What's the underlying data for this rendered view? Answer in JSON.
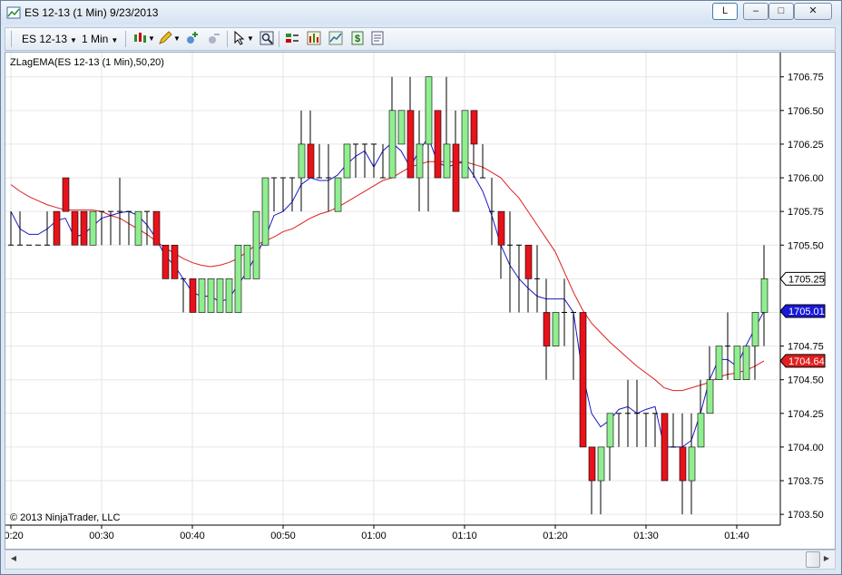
{
  "window": {
    "title": "ES 12-13 (1 Min)  9/23/2013",
    "buttons": {
      "layout": "L",
      "minimize": "–",
      "maximize": "□",
      "close": "✕"
    }
  },
  "toolbar": {
    "instrument": "ES 12-13",
    "interval": "1 Min",
    "icons": [
      "candlestick-style-icon",
      "pencil-draw-icon",
      "add-indicator-icon",
      "remove-indicator-icon",
      "cursor-icon",
      "zoom-icon",
      "strategies-icon",
      "chart-bars-icon",
      "data-box-icon",
      "money-icon",
      "properties-icon"
    ]
  },
  "colors": {
    "up_bar": "#90ee90",
    "down_bar": "#e8121b",
    "fast_ema": "#1919c8",
    "slow_ema": "#e01e1e",
    "grid": "#e6e6e6"
  },
  "chart": {
    "indicator_label": "ZLagEMA(ES 12-13 (1 Min),50,20)",
    "copyright": "© 2013 NinjaTrader, LLC",
    "price_badges": [
      {
        "text": "1705.25",
        "style": "last"
      },
      {
        "text": "1705.01",
        "style": "fast"
      },
      {
        "text": "1704.64",
        "style": "slow"
      }
    ]
  },
  "chart_data": {
    "type": "candlestick",
    "y_ticks": [
      "1706.75",
      "1706.50",
      "1706.25",
      "1706.00",
      "1705.75",
      "1705.50",
      "1705.25",
      "1705.00",
      "1704.75",
      "1704.50",
      "1704.25",
      "1704.00",
      "1703.75",
      "1703.50"
    ],
    "ylim": [
      1703.42,
      1706.93
    ],
    "x_ticks": [
      {
        "label": "00:20",
        "index": 0
      },
      {
        "label": "00:30",
        "index": 10
      },
      {
        "label": "00:40",
        "index": 20
      },
      {
        "label": "00:50",
        "index": 30
      },
      {
        "label": "01:00",
        "index": 40
      },
      {
        "label": "01:10",
        "index": 50
      },
      {
        "label": "01:20",
        "index": 60
      },
      {
        "label": "01:30",
        "index": 70
      },
      {
        "label": "01:40",
        "index": 80
      }
    ],
    "bars": [
      [
        1705.5,
        1705.75,
        1705.5,
        1705.5
      ],
      [
        1705.5,
        1705.75,
        1705.5,
        1705.5
      ],
      [
        1705.5,
        1705.5,
        1705.5,
        1705.5
      ],
      [
        1705.5,
        1705.5,
        1705.5,
        1705.5
      ],
      [
        1705.5,
        1705.75,
        1705.5,
        1705.5
      ],
      [
        1705.75,
        1705.75,
        1705.5,
        1705.5
      ],
      [
        1706.0,
        1706.0,
        1705.75,
        1705.75
      ],
      [
        1705.75,
        1705.75,
        1705.5,
        1705.5
      ],
      [
        1705.75,
        1705.75,
        1705.5,
        1705.5
      ],
      [
        1705.5,
        1705.75,
        1705.5,
        1705.75
      ],
      [
        1705.75,
        1705.75,
        1705.5,
        1705.75
      ],
      [
        1705.75,
        1705.75,
        1705.5,
        1705.75
      ],
      [
        1705.75,
        1706.0,
        1705.5,
        1705.75
      ],
      [
        1705.75,
        1705.75,
        1705.5,
        1705.75
      ],
      [
        1705.5,
        1705.75,
        1705.5,
        1705.75
      ],
      [
        1705.75,
        1705.75,
        1705.5,
        1705.75
      ],
      [
        1705.75,
        1705.75,
        1705.5,
        1705.5
      ],
      [
        1705.5,
        1705.5,
        1705.25,
        1705.25
      ],
      [
        1705.5,
        1705.5,
        1705.25,
        1705.25
      ],
      [
        1705.25,
        1705.25,
        1705.0,
        1705.25
      ],
      [
        1705.25,
        1705.25,
        1705.0,
        1705.0
      ],
      [
        1705.0,
        1705.25,
        1705.0,
        1705.25
      ],
      [
        1705.0,
        1705.25,
        1705.0,
        1705.25
      ],
      [
        1705.0,
        1705.25,
        1705.0,
        1705.25
      ],
      [
        1705.0,
        1705.25,
        1705.0,
        1705.25
      ],
      [
        1705.0,
        1705.5,
        1705.0,
        1705.5
      ],
      [
        1705.25,
        1705.5,
        1705.25,
        1705.5
      ],
      [
        1705.25,
        1705.75,
        1705.25,
        1705.75
      ],
      [
        1705.5,
        1706.0,
        1705.5,
        1706.0
      ],
      [
        1706.0,
        1706.0,
        1705.75,
        1706.0
      ],
      [
        1706.0,
        1706.0,
        1705.75,
        1706.0
      ],
      [
        1706.0,
        1706.0,
        1705.75,
        1706.0
      ],
      [
        1706.0,
        1706.5,
        1705.75,
        1706.25
      ],
      [
        1706.25,
        1706.5,
        1706.0,
        1706.0
      ],
      [
        1706.0,
        1706.25,
        1706.0,
        1706.0
      ],
      [
        1706.0,
        1706.25,
        1705.75,
        1706.0
      ],
      [
        1705.75,
        1706.0,
        1705.75,
        1706.0
      ],
      [
        1706.0,
        1706.25,
        1706.0,
        1706.25
      ],
      [
        1706.25,
        1706.25,
        1706.0,
        1706.25
      ],
      [
        1706.25,
        1706.25,
        1706.0,
        1706.25
      ],
      [
        1706.25,
        1706.25,
        1706.0,
        1706.25
      ],
      [
        1706.0,
        1706.25,
        1706.0,
        1706.0
      ],
      [
        1706.0,
        1706.75,
        1706.25,
        1706.5
      ],
      [
        1706.25,
        1706.5,
        1706.25,
        1706.5
      ],
      [
        1706.5,
        1706.75,
        1706.0,
        1706.0
      ],
      [
        1706.0,
        1706.5,
        1705.75,
        1706.25
      ],
      [
        1706.25,
        1706.75,
        1705.75,
        1706.75
      ],
      [
        1706.5,
        1706.5,
        1706.0,
        1706.0
      ],
      [
        1706.0,
        1706.75,
        1706.0,
        1706.25
      ],
      [
        1706.25,
        1706.5,
        1705.75,
        1705.75
      ],
      [
        1706.0,
        1706.5,
        1706.25,
        1706.5
      ],
      [
        1706.5,
        1706.5,
        1706.0,
        1706.25
      ],
      [
        1706.0,
        1706.25,
        1706.0,
        1706.0
      ],
      [
        1705.75,
        1706.0,
        1705.5,
        1705.75
      ],
      [
        1705.75,
        1705.75,
        1705.25,
        1705.5
      ],
      [
        1705.5,
        1705.75,
        1705.0,
        1705.5
      ],
      [
        1705.5,
        1705.5,
        1705.0,
        1705.5
      ],
      [
        1705.5,
        1705.5,
        1705.0,
        1705.25
      ],
      [
        1705.25,
        1705.5,
        1705.0,
        1705.25
      ],
      [
        1705.0,
        1705.25,
        1704.5,
        1704.75
      ],
      [
        1704.75,
        1705.0,
        1704.75,
        1705.0
      ],
      [
        1705.0,
        1705.25,
        1704.75,
        1705.0
      ],
      [
        1705.0,
        1705.0,
        1704.5,
        1705.0
      ],
      [
        1705.0,
        1705.0,
        1704.0,
        1704.0
      ],
      [
        1704.0,
        1704.0,
        1703.5,
        1703.75
      ],
      [
        1703.75,
        1704.0,
        1703.5,
        1704.0
      ],
      [
        1704.0,
        1704.25,
        1703.75,
        1704.25
      ],
      [
        1704.25,
        1704.25,
        1704.0,
        1704.25
      ],
      [
        1704.25,
        1704.5,
        1704.0,
        1704.25
      ],
      [
        1704.25,
        1704.5,
        1704.0,
        1704.25
      ],
      [
        1704.25,
        1704.25,
        1704.0,
        1704.25
      ],
      [
        1704.25,
        1704.25,
        1704.0,
        1704.25
      ],
      [
        1704.25,
        1704.25,
        1703.75,
        1703.75
      ],
      [
        1704.0,
        1704.25,
        1704.0,
        1704.0
      ],
      [
        1704.0,
        1704.25,
        1703.5,
        1703.75
      ],
      [
        1703.75,
        1704.25,
        1703.5,
        1704.0
      ],
      [
        1704.0,
        1704.5,
        1704.0,
        1704.25
      ],
      [
        1704.25,
        1704.75,
        1704.25,
        1704.5
      ],
      [
        1704.5,
        1704.75,
        1704.5,
        1704.75
      ],
      [
        1704.75,
        1705.0,
        1704.5,
        1704.75
      ],
      [
        1704.5,
        1704.75,
        1704.5,
        1704.75
      ],
      [
        1704.5,
        1704.75,
        1704.5,
        1704.75
      ],
      [
        1704.75,
        1705.0,
        1704.5,
        1705.0
      ],
      [
        1705.0,
        1705.5,
        1704.75,
        1705.25
      ]
    ],
    "series": [
      {
        "name": "fast",
        "values": [
          1705.75,
          1705.62,
          1705.58,
          1705.58,
          1705.62,
          1705.68,
          1705.7,
          1705.56,
          1705.58,
          1705.64,
          1705.7,
          1705.72,
          1705.74,
          1705.75,
          1705.72,
          1705.65,
          1705.55,
          1705.42,
          1705.35,
          1705.25,
          1705.15,
          1705.12,
          1705.12,
          1705.08,
          1705.1,
          1705.2,
          1705.3,
          1705.42,
          1705.55,
          1705.72,
          1705.75,
          1705.82,
          1705.95,
          1706.0,
          1705.98,
          1705.98,
          1706.02,
          1706.1,
          1706.16,
          1706.2,
          1706.08,
          1706.2,
          1706.26,
          1706.2,
          1706.08,
          1706.2,
          1706.3,
          1706.12,
          1706.08,
          1706.1,
          1706.12,
          1706.02,
          1705.9,
          1705.72,
          1705.5,
          1705.35,
          1705.25,
          1705.18,
          1705.12,
          1705.1,
          1705.1,
          1705.1,
          1705.0,
          1704.55,
          1704.25,
          1704.15,
          1704.2,
          1704.28,
          1704.3,
          1704.25,
          1704.28,
          1704.3,
          1704.0,
          1704.0,
          1704.0,
          1704.05,
          1704.25,
          1704.5,
          1704.65,
          1704.65,
          1704.6,
          1704.75,
          1704.88,
          1705.01
        ]
      },
      {
        "name": "slow",
        "values": [
          1705.95,
          1705.9,
          1705.86,
          1705.83,
          1705.8,
          1705.78,
          1705.76,
          1705.76,
          1705.76,
          1705.76,
          1705.75,
          1705.72,
          1705.7,
          1705.66,
          1705.62,
          1705.58,
          1705.53,
          1705.48,
          1705.44,
          1705.4,
          1705.37,
          1705.35,
          1705.34,
          1705.35,
          1705.37,
          1705.4,
          1705.45,
          1705.5,
          1705.53,
          1705.56,
          1705.6,
          1705.62,
          1705.66,
          1705.7,
          1705.73,
          1705.75,
          1705.78,
          1705.82,
          1705.86,
          1705.9,
          1705.94,
          1705.98,
          1706.0,
          1706.04,
          1706.08,
          1706.1,
          1706.12,
          1706.12,
          1706.12,
          1706.12,
          1706.12,
          1706.1,
          1706.08,
          1706.04,
          1706.0,
          1705.92,
          1705.85,
          1705.75,
          1705.65,
          1705.55,
          1705.45,
          1705.3,
          1705.15,
          1705.02,
          1704.92,
          1704.85,
          1704.78,
          1704.72,
          1704.66,
          1704.6,
          1704.55,
          1704.5,
          1704.44,
          1704.42,
          1704.42,
          1704.44,
          1704.46,
          1704.48,
          1704.52,
          1704.54,
          1704.55,
          1704.57,
          1704.6,
          1704.64
        ]
      }
    ],
    "grid": true
  }
}
